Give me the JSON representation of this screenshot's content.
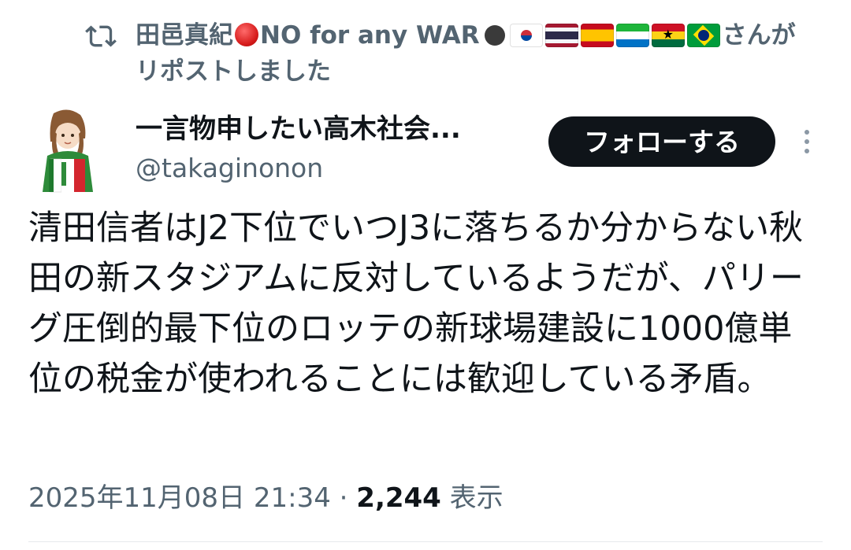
{
  "repost": {
    "reposter_name": "田邑真紀",
    "reposter_suffix": "NO for any WAR",
    "flags": [
      "south-korea",
      "thailand",
      "spain",
      "sierra-leone",
      "ghana",
      "brazil"
    ],
    "trailing_text": "さんが",
    "second_line": "リポストしました",
    "icon": "repost-icon"
  },
  "author": {
    "display_name": "一言物申したい高木社会...",
    "handle": "@takaginonon"
  },
  "follow_button": {
    "label": "フォローする"
  },
  "tweet": {
    "text": "清田信者はJ2下位でいつJ3に落ちるか分からない秋田の新スタジアムに反対しているようだが、パリーグ圧倒的最下位のロッテの新球場建設に1000億単位の税金が使われることには歓迎している矛盾。"
  },
  "meta": {
    "timestamp": "2025年11月08日 21:34",
    "separator": "·",
    "views_count": "2,244",
    "views_label": "表示"
  },
  "colors": {
    "text_primary": "#0f1419",
    "text_secondary": "#536471",
    "button_bg": "#0f1419",
    "button_text": "#ffffff"
  }
}
